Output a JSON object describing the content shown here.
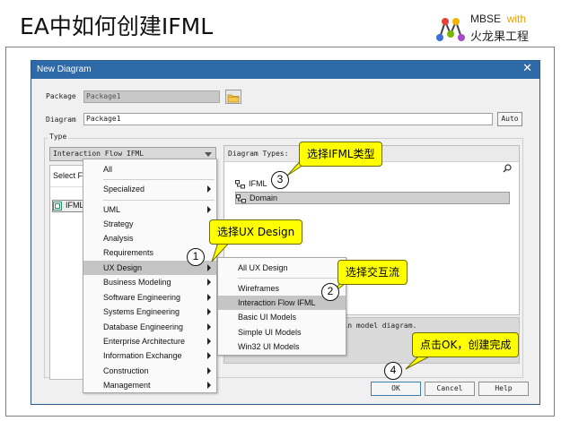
{
  "slide": {
    "title": "EA中如何创建IFML",
    "logo_mbse": "MBSE",
    "logo_with": "with",
    "logo_cn": "火龙果工程"
  },
  "dialog": {
    "title": "New Diagram",
    "package_label": "Package",
    "package_value": "Package1",
    "diagram_label": "Diagram",
    "diagram_value": "Package1",
    "auto_button": "Auto",
    "type_legend": "Type",
    "type_selected": "Interaction Flow IFML",
    "select_from_label": "Select Fr",
    "select_from_item": "IFML",
    "diagram_types_label": "Diagram Types:",
    "diagram_types": [
      {
        "label": "IFML",
        "selected": false
      },
      {
        "label": "Domain",
        "selected": true
      }
    ],
    "description_fragment": "omain model diagram.",
    "ok_button": "OK",
    "cancel_button": "Cancel",
    "help_button": "Help"
  },
  "menu_main": {
    "items": [
      {
        "label": "All",
        "submenu": false
      },
      {
        "label": "Specialized",
        "submenu": true
      },
      {
        "label": "UML",
        "submenu": true
      },
      {
        "label": "Strategy",
        "submenu": false
      },
      {
        "label": "Analysis",
        "submenu": false
      },
      {
        "label": "Requirements",
        "submenu": false
      },
      {
        "label": "UX Design",
        "submenu": true,
        "highlighted": true
      },
      {
        "label": "Business Modeling",
        "submenu": true
      },
      {
        "label": "Software Engineering",
        "submenu": true
      },
      {
        "label": "Systems Engineering",
        "submenu": true
      },
      {
        "label": "Database Engineering",
        "submenu": true
      },
      {
        "label": "Enterprise Architecture",
        "submenu": true
      },
      {
        "label": "Information Exchange",
        "submenu": true
      },
      {
        "label": "Construction",
        "submenu": true
      },
      {
        "label": "Management",
        "submenu": true
      }
    ]
  },
  "menu_sub": {
    "items": [
      {
        "label": "All UX Design"
      },
      {
        "label": "Wireframes"
      },
      {
        "label": "Interaction Flow IFML",
        "highlighted": true
      },
      {
        "label": "Basic UI Models"
      },
      {
        "label": "Simple UI Models"
      },
      {
        "label": "Win32 UI Models"
      }
    ]
  },
  "callouts": {
    "c1": "选择UX Design",
    "c2": "选择交互流",
    "c3": "选择IFML类型",
    "c4": "点击OK，创建完成"
  },
  "steps": {
    "s1": "1",
    "s2": "2",
    "s3": "3",
    "s4": "4"
  },
  "colors": {
    "callout": "#ffff00",
    "titlebar": "#2e6aa8",
    "logo_with": "#e6a100"
  }
}
